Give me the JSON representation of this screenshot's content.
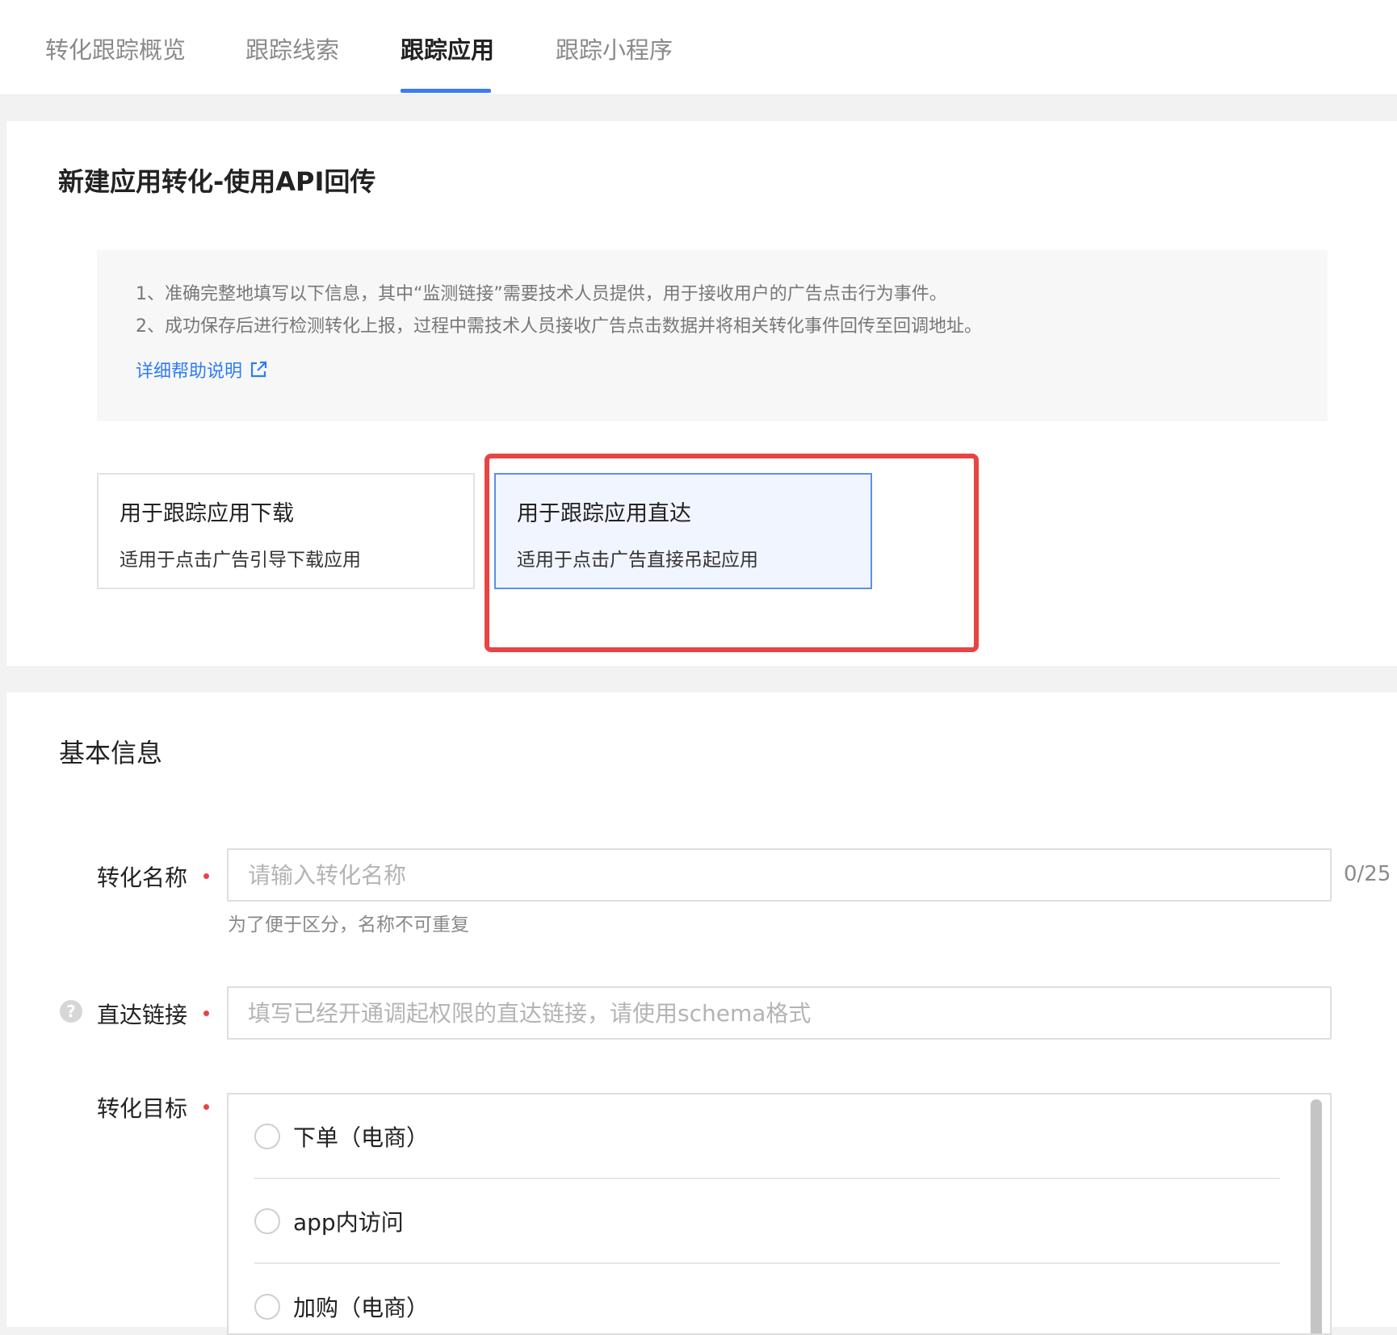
{
  "tabs": [
    {
      "label": "转化跟踪概览"
    },
    {
      "label": "跟踪线索"
    },
    {
      "label": "跟踪应用"
    },
    {
      "label": "跟踪小程序"
    }
  ],
  "active_tab": "跟踪应用",
  "page": {
    "title": "新建应用转化-使用API回传"
  },
  "info": {
    "line1": "1、准确完整地填写以下信息，其中“监测链接”需要技术人员提供，用于接收用户的广告点击行为事件。",
    "line2": "2、成功保存后进行检测转化上报，过程中需技术人员接收广告点击数据并将相关转化事件回传至回调地址。",
    "help_link": "详细帮助说明"
  },
  "options": [
    {
      "title": "用于跟踪应用下载",
      "desc": "适用于点击广告引导下载应用",
      "selected": false
    },
    {
      "title": "用于跟踪应用直达",
      "desc": "适用于点击广告直接吊起应用",
      "selected": true
    }
  ],
  "basic_info": {
    "title": "基本信息",
    "name_field": {
      "label": "转化名称",
      "placeholder": "请输入转化名称",
      "counter": "0/25",
      "hint": "为了便于区分，名称不可重复"
    },
    "link_field": {
      "label": "直达链接",
      "placeholder": "填写已经开通调起权限的直达链接，请使用schema格式",
      "help_icon": "?"
    },
    "target_field": {
      "label": "转化目标",
      "options": [
        {
          "label": "下单（电商）"
        },
        {
          "label": "app内访问"
        },
        {
          "label": "加购（电商）"
        }
      ]
    }
  },
  "colors": {
    "accent": "#3b7cf0",
    "link": "#2f7cf6",
    "highlight": "#e84444",
    "selected_bg": "#f1f5ff"
  },
  "icons": {
    "external_link": "external-link-icon",
    "help": "question-circle-icon"
  }
}
